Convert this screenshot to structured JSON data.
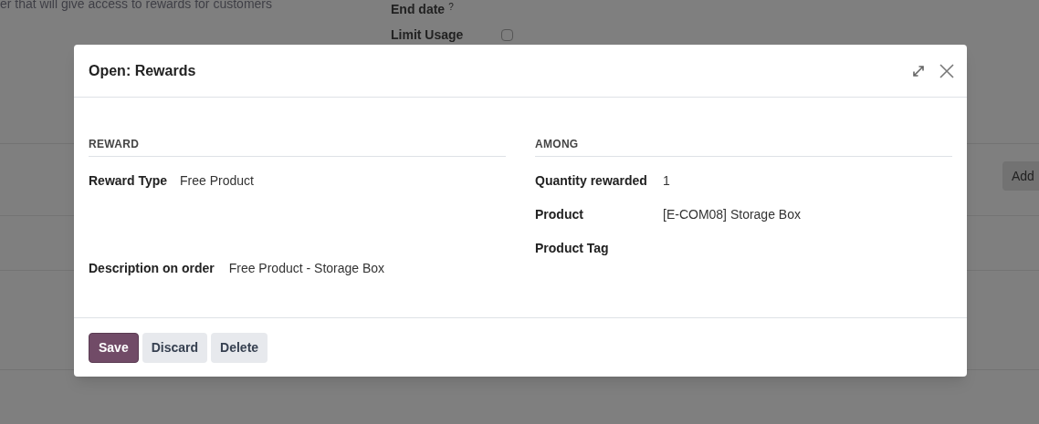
{
  "background": {
    "description_text": "er that will give access to rewards for customers",
    "end_date_label": "End date",
    "end_date_help": "?",
    "limit_usage_label": "Limit Usage",
    "limit_usage_checked": false,
    "add_button": "Add"
  },
  "dialog": {
    "title": "Open: Rewards",
    "left": {
      "heading": "REWARD",
      "fields": [
        {
          "label": "Reward Type",
          "value": "Free Product"
        }
      ],
      "bottom_field": {
        "label": "Description on order",
        "value": "Free Product - Storage Box"
      }
    },
    "right": {
      "heading": "AMONG",
      "fields": [
        {
          "label": "Quantity rewarded",
          "value": "1"
        },
        {
          "label": "Product",
          "value": "[E-COM08] Storage Box"
        },
        {
          "label": "Product Tag"
        }
      ]
    },
    "buttons": [
      {
        "label": "Save",
        "kind": "primary"
      },
      {
        "label": "Discard",
        "kind": "secondary"
      },
      {
        "label": "Delete",
        "kind": "secondary"
      }
    ]
  }
}
